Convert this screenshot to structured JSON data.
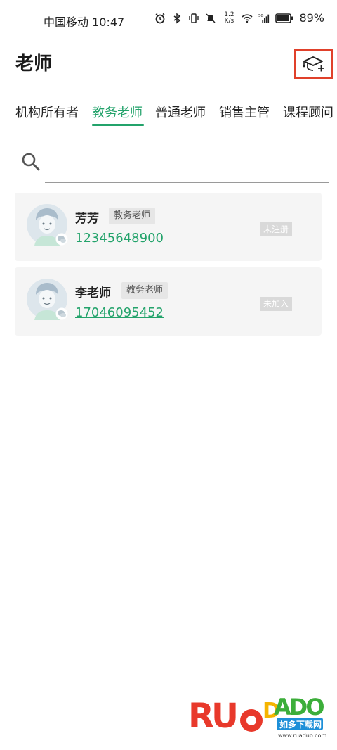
{
  "status_bar": {
    "carrier_time": "中国移动 10:47",
    "net_speed_value": "1.2",
    "net_speed_unit": "K/s",
    "signal_label": "5G",
    "battery": "89%"
  },
  "header": {
    "title": "老师",
    "add_icon": "graduation-cap-plus-icon"
  },
  "tabs": [
    {
      "label": "机构所有者",
      "active": false
    },
    {
      "label": "教务老师",
      "active": true
    },
    {
      "label": "普通老师",
      "active": false
    },
    {
      "label": "销售主管",
      "active": false
    },
    {
      "label": "课程顾问",
      "active": false
    }
  ],
  "search": {
    "placeholder": "",
    "value": ""
  },
  "teachers": [
    {
      "name": "芳芳",
      "role": "教务老师",
      "phone": "12345648900",
      "status": "未注册"
    },
    {
      "name": "李老师",
      "role": "教务老师",
      "phone": "17046095452",
      "status": "未加入"
    }
  ],
  "watermark": {
    "brand": "RUANDAO",
    "tagline": "如多下载网",
    "url": "www.ruaduo.com"
  },
  "colors": {
    "accent": "#23a36b",
    "highlight_box": "#e0402a",
    "card_bg": "#f5f5f5"
  }
}
